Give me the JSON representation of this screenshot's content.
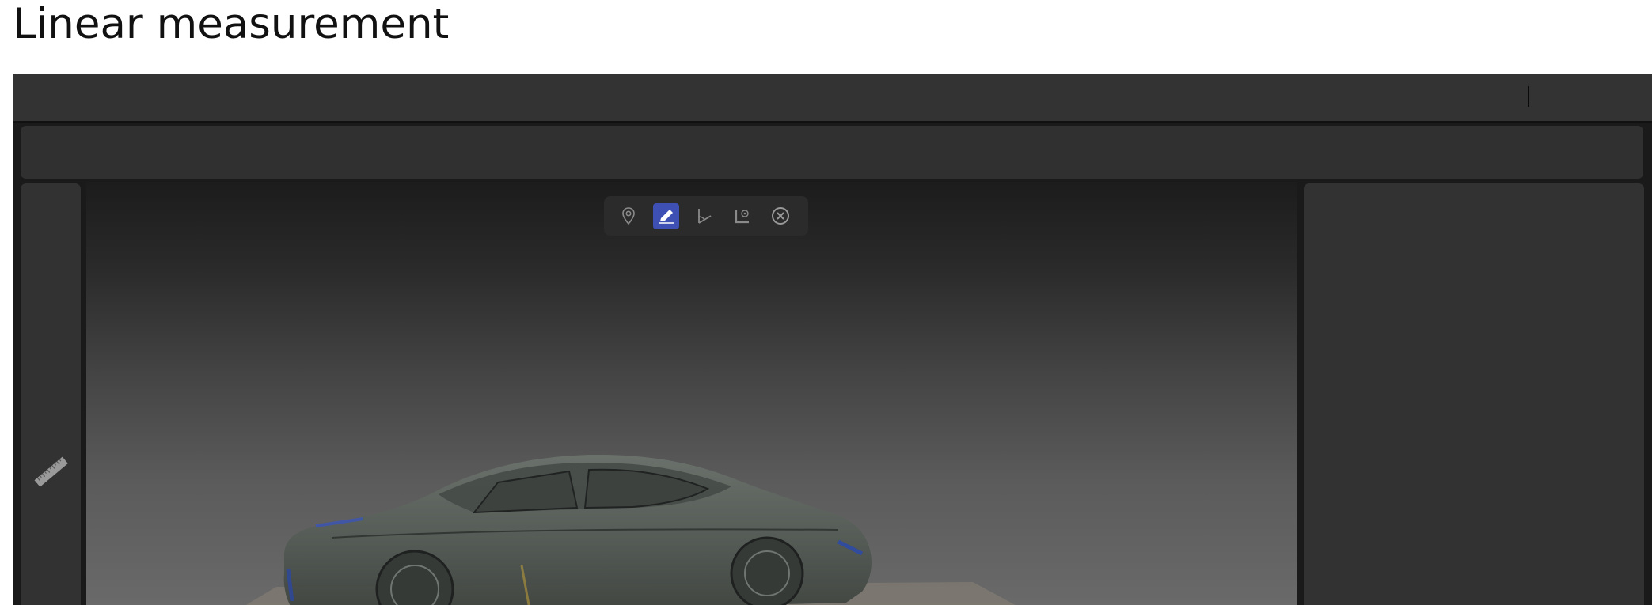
{
  "page": {
    "title": "Linear measurement"
  },
  "viewer": {
    "measure_toolbar": {
      "tools": [
        {
          "name": "point-marker",
          "icon": "location-pin-icon",
          "active": false
        },
        {
          "name": "linear-measure",
          "icon": "ruler-pencil-icon",
          "active": true
        },
        {
          "name": "angle-measure",
          "icon": "angle-icon",
          "active": false
        },
        {
          "name": "area-measure",
          "icon": "area-icon",
          "active": false
        },
        {
          "name": "clear-measurements",
          "icon": "close-circle-icon",
          "active": false
        }
      ]
    },
    "sidebar": {
      "items": [
        {
          "icon": "ruler-icon",
          "active": true
        }
      ]
    },
    "colors": {
      "accent": "#3e50b4",
      "header": "#333333",
      "panel": "#323232",
      "frame": "#1a1a1a"
    }
  }
}
